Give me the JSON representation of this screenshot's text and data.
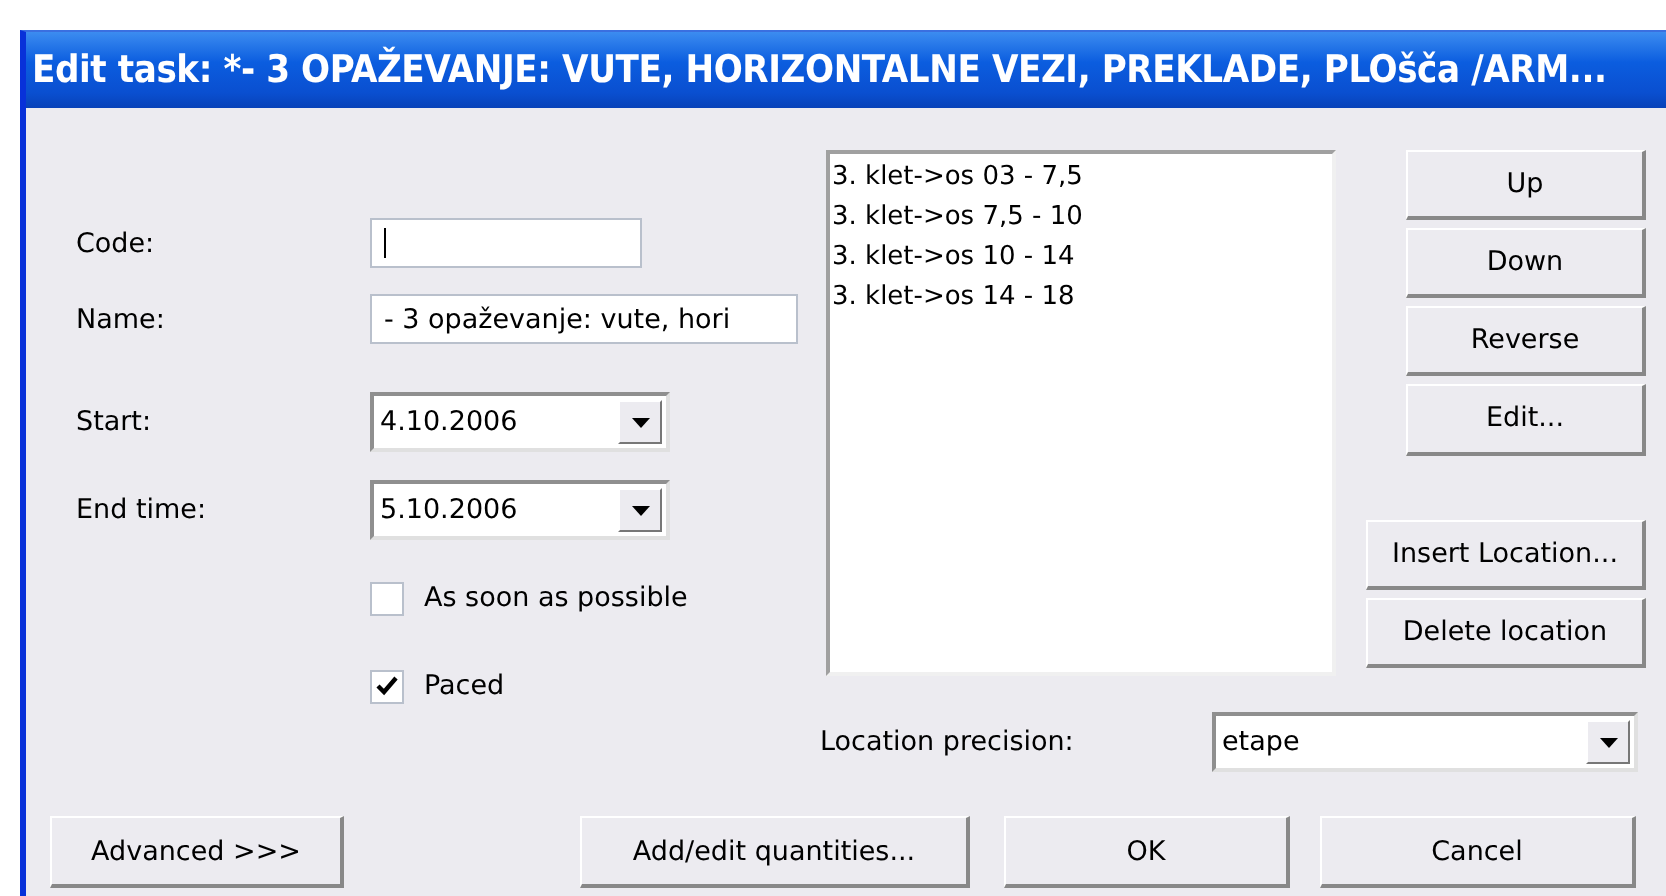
{
  "window": {
    "title": "Edit task: *- 3 OPAŽEVANJE: VUTE, HORIZONTALNE VEZI, PREKLADE, PLOšča /ARM..."
  },
  "fields": [
    {
      "label": "Code:",
      "kind": "text"
    },
    {
      "label": "Name:",
      "kind": "text",
      "value": "- 3 opaževanje: vute, hori"
    },
    {
      "label": "Start:",
      "kind": "combo",
      "value": "4.10.2006"
    },
    {
      "label": "End time:",
      "kind": "combo",
      "value": "5.10.2006"
    }
  ],
  "checkboxes": [
    {
      "label": "As soon as possible",
      "checked": false
    },
    {
      "label": "Paced",
      "checked": true
    }
  ],
  "locations": [
    "3. klet->os 03 - 7,5",
    "3. klet->os 7,5 - 10",
    "3. klet->os 10 - 14",
    "3. klet->os 14 - 18"
  ],
  "list_buttons": [
    "Up",
    "Down",
    "Reverse",
    "Edit..."
  ],
  "location_buttons": [
    "Insert Location...",
    "Delete location"
  ],
  "location_precision": {
    "label": "Location precision:",
    "value": "etape"
  },
  "bottom_buttons": [
    "Advanced >>>",
    "Add/edit quantities...",
    "OK",
    "Cancel"
  ]
}
